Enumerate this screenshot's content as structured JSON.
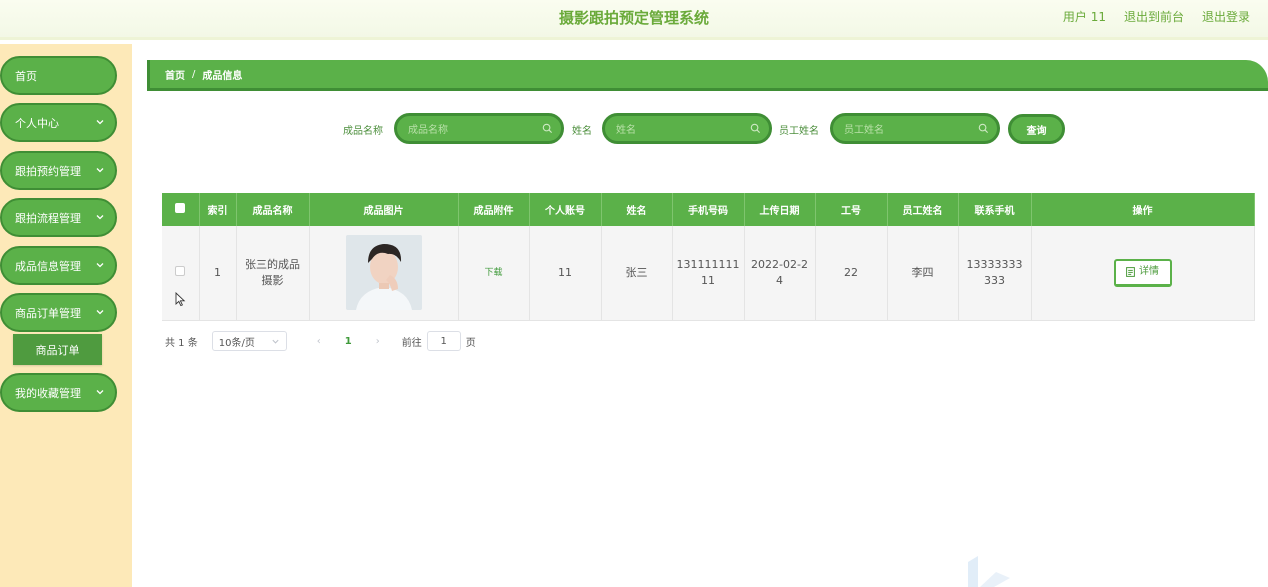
{
  "header": {
    "title": "摄影跟拍预定管理系统",
    "user_label": "用户 11",
    "exit_front_label": "退出到前台",
    "logout_label": "退出登录"
  },
  "sidebar": {
    "items": [
      {
        "label": "首页",
        "expandable": false
      },
      {
        "label": "个人中心",
        "expandable": true
      },
      {
        "label": "跟拍预约管理",
        "expandable": true
      },
      {
        "label": "跟拍流程管理",
        "expandable": true
      },
      {
        "label": "成品信息管理",
        "expandable": true
      },
      {
        "label": "商品订单管理",
        "expandable": true
      },
      {
        "label": "我的收藏管理",
        "expandable": true
      }
    ],
    "submenu_label": "商品订单"
  },
  "breadcrumb": {
    "home": "首页",
    "separator": "/",
    "current": "成品信息"
  },
  "search": {
    "product_name_label": "成品名称",
    "product_name_placeholder": "成品名称",
    "name_label": "姓名",
    "name_placeholder": "姓名",
    "staff_name_label": "员工姓名",
    "staff_name_placeholder": "员工姓名",
    "query_button": "查询"
  },
  "table": {
    "headers": [
      "索引",
      "成品名称",
      "成品图片",
      "成品附件",
      "个人账号",
      "姓名",
      "手机号码",
      "上传日期",
      "工号",
      "员工姓名",
      "联系手机",
      "操作"
    ],
    "rows": [
      {
        "index": "1",
        "product_name": "张三的成品摄影",
        "attachment": "下载",
        "account": "11",
        "name": "张三",
        "phone": "13111111111",
        "upload_date": "2022-02-24",
        "staff_no": "22",
        "staff_name": "李四",
        "contact_phone": "13333333333",
        "action": "详情"
      }
    ]
  },
  "pagination": {
    "total": "共 1 条",
    "page_size": "10条/页",
    "current_page": "1",
    "goto_label": "前往",
    "goto_value": "1",
    "page_suffix": "页"
  },
  "colors": {
    "primary": "#5bb149",
    "primary_dark": "#3f8e35",
    "sidebar_bg": "#fde9b8",
    "header_text": "#6aaa3a"
  }
}
